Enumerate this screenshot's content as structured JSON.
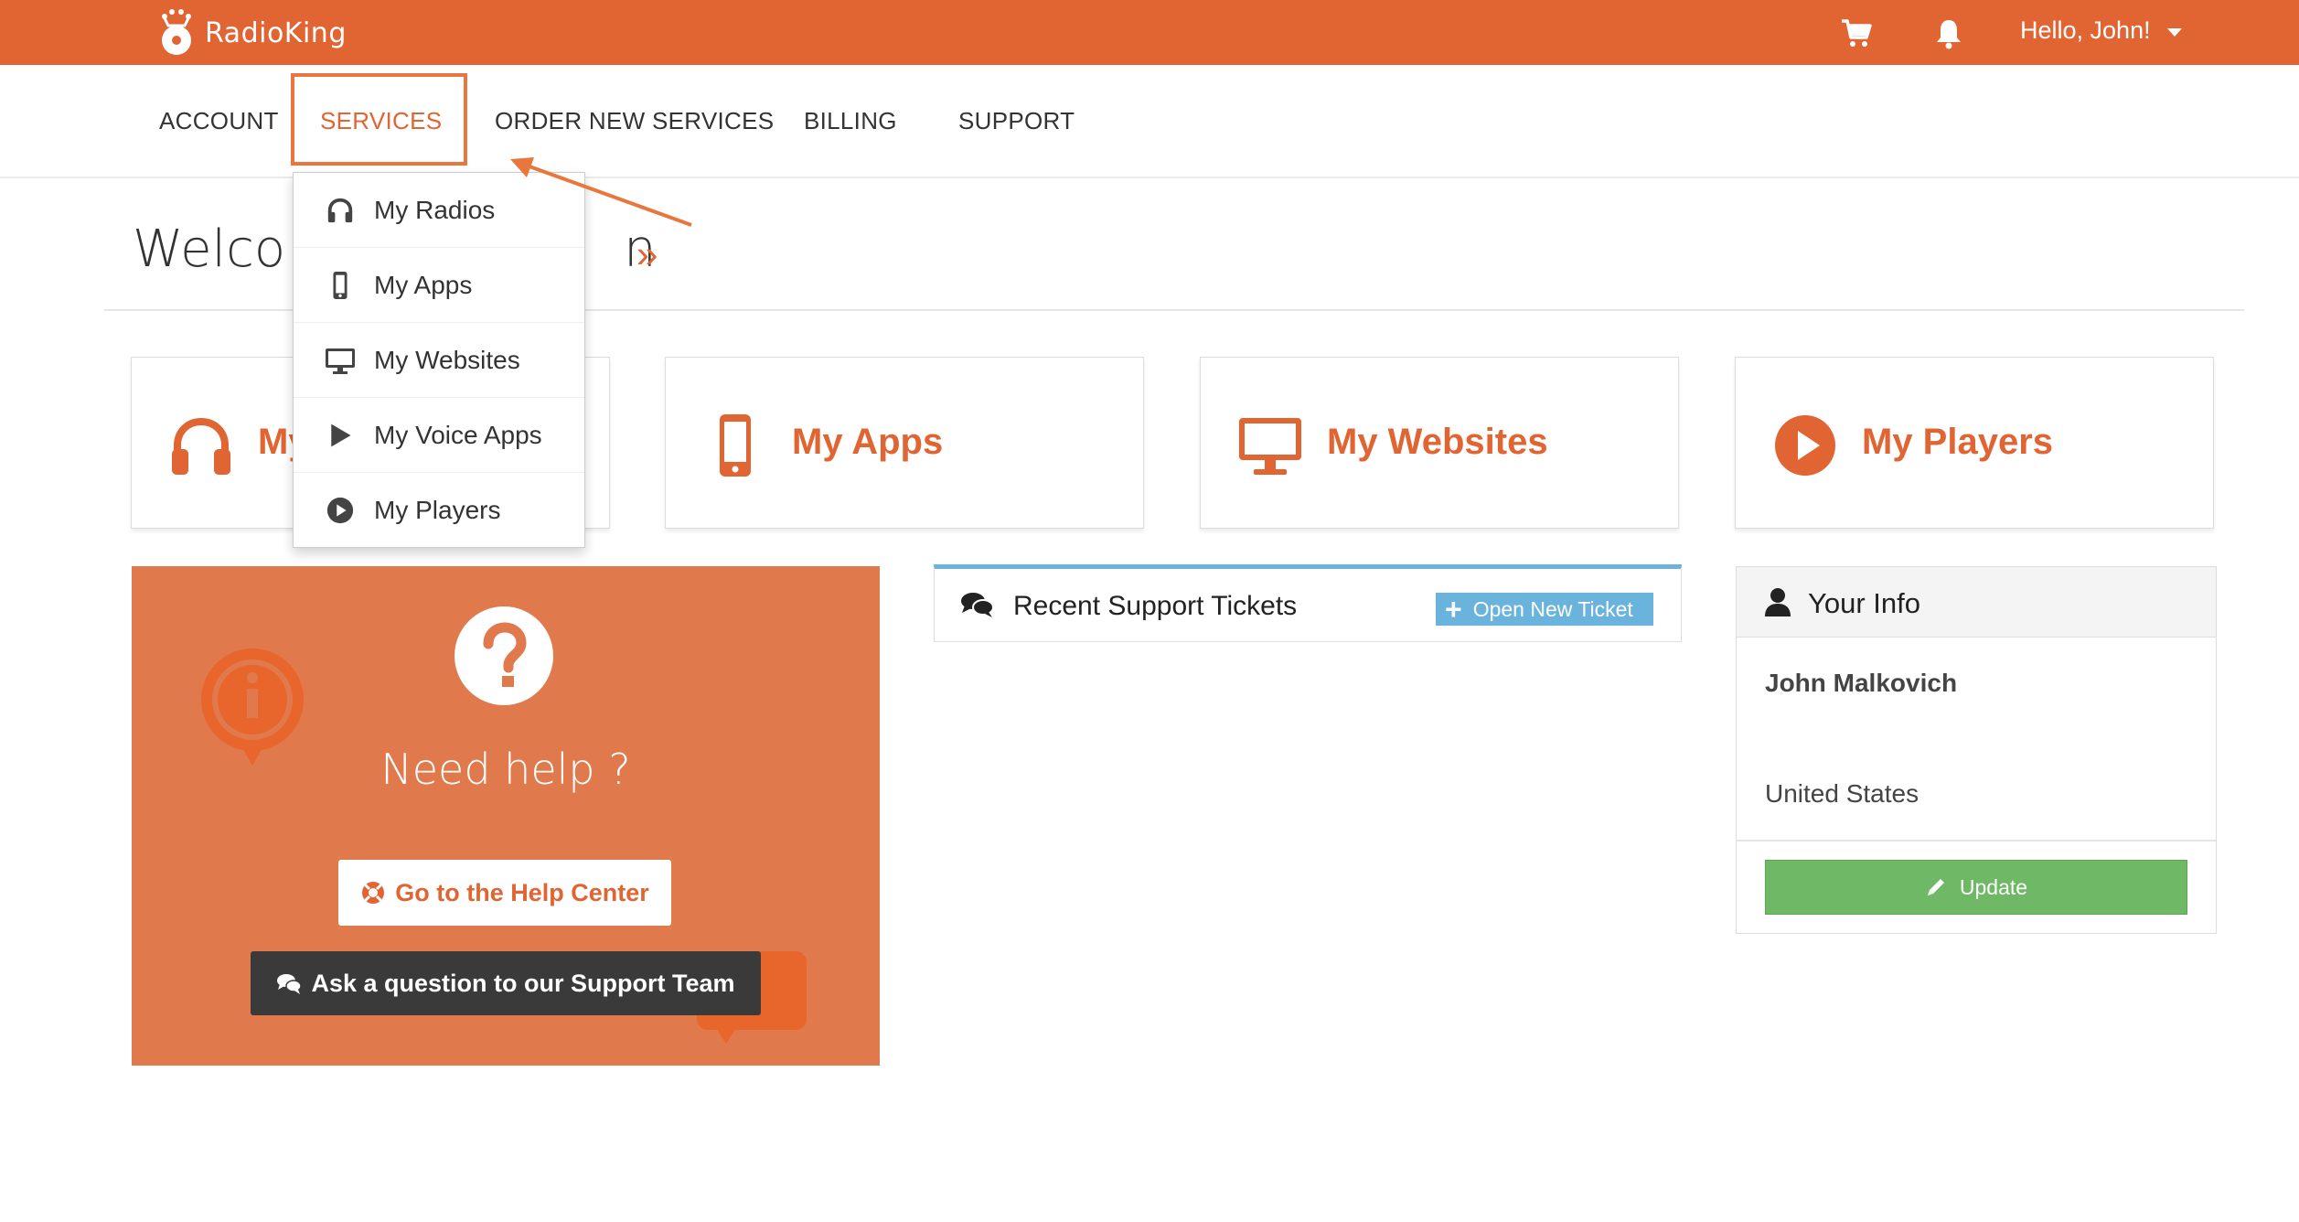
{
  "brand": {
    "name": "RadioKing"
  },
  "topbar": {
    "greeting": "Hello, John!",
    "cart_icon": "cart-icon",
    "bell_icon": "bell-icon"
  },
  "nav": {
    "items": [
      {
        "label": "ACCOUNT"
      },
      {
        "label": "SERVICES"
      },
      {
        "label": "ORDER NEW SERVICES"
      },
      {
        "label": "BILLING"
      },
      {
        "label": "SUPPORT"
      }
    ],
    "active": "SERVICES"
  },
  "dropdown": {
    "items": [
      {
        "label": "My Radios",
        "icon": "headphones-icon"
      },
      {
        "label": "My Apps",
        "icon": "mobile-icon"
      },
      {
        "label": "My Websites",
        "icon": "desktop-icon"
      },
      {
        "label": "My Voice Apps",
        "icon": "play-triangle-icon"
      },
      {
        "label": "My Players",
        "icon": "play-circle-icon"
      }
    ]
  },
  "welcome": {
    "visible_start": "Welco",
    "visible_end": "n",
    "raquo": "»"
  },
  "cards": [
    {
      "label": "My Radios",
      "visible_label": "My",
      "icon": "headphones-icon"
    },
    {
      "label": "My Apps",
      "icon": "mobile-icon"
    },
    {
      "label": "My Websites",
      "icon": "desktop-icon"
    },
    {
      "label": "My Players",
      "icon": "play-circle-icon"
    }
  ],
  "help": {
    "title": "Need help ?",
    "help_center_label": "Go to the Help Center",
    "ask_label": "Ask a question to our Support Team"
  },
  "tickets": {
    "title": "Recent Support Tickets",
    "open_label": "Open New Ticket"
  },
  "info": {
    "title": "Your Info",
    "name": "John Malkovich",
    "country": "United States",
    "update_label": "Update"
  },
  "colors": {
    "brand": "#e16433",
    "help_bg": "#e07a4c",
    "tickets_accent": "#6ab3dd",
    "update_green": "#6fb865"
  }
}
